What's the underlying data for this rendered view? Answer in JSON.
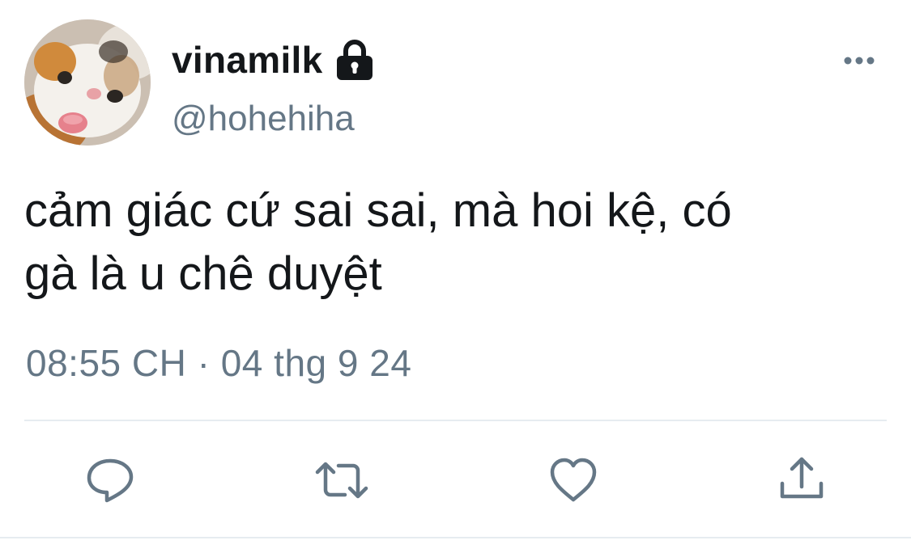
{
  "tweet": {
    "display_name": "vinamilk",
    "handle": "@hohehiha",
    "text_line1": "cảm giác cứ sai sai, mà hoi kệ, có",
    "text_line2": "gà là u chê duyệt",
    "timestamp": "08:55 CH · 04 thg 9 24",
    "protected": true
  },
  "icons": {
    "avatar": "cat-avatar",
    "lock": "lock-icon",
    "more": "more-icon",
    "reply": "reply-icon",
    "retweet": "retweet-icon",
    "like": "like-icon",
    "share": "share-icon"
  },
  "colors": {
    "text": "#14171a",
    "secondary": "#657786",
    "divider": "#e6ecf0",
    "action_icon": "#657786"
  }
}
